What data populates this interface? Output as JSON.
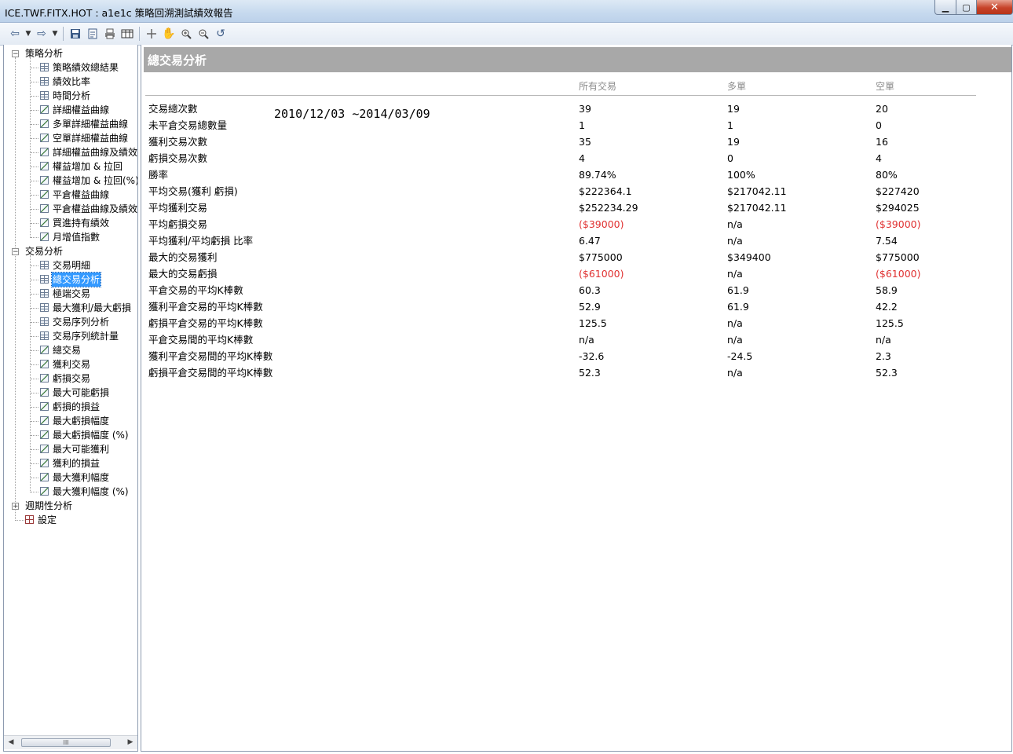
{
  "window": {
    "title": "ICE.TWF.FITX.HOT : a1e1c 策略回溯測試績效報告",
    "buttons": {
      "minimize": "▁",
      "maximize": "▢",
      "close": "✕"
    }
  },
  "toolbar": {
    "icons": [
      "back-icon",
      "forward-icon",
      "save-icon",
      "export-icon",
      "print-icon",
      "table-view-icon",
      "crosshair-icon",
      "pan-hand-icon",
      "zoom-in-icon",
      "zoom-out-icon",
      "reset-zoom-icon"
    ]
  },
  "tree": {
    "groups": [
      {
        "label": "策略分析",
        "expanded": true,
        "items": [
          {
            "label": "策略績效總結果",
            "icon": "grid"
          },
          {
            "label": "績效比率",
            "icon": "grid"
          },
          {
            "label": "時間分析",
            "icon": "grid"
          },
          {
            "label": "詳細權益曲線",
            "icon": "chart"
          },
          {
            "label": "多單詳細權益曲線",
            "icon": "chart"
          },
          {
            "label": "空單詳細權益曲線",
            "icon": "chart"
          },
          {
            "label": "詳細權益曲線及績效",
            "icon": "chart"
          },
          {
            "label": "權益增加 & 拉回",
            "icon": "chart"
          },
          {
            "label": "權益增加 & 拉回(%)",
            "icon": "chart"
          },
          {
            "label": "平倉權益曲線",
            "icon": "chart"
          },
          {
            "label": "平倉權益曲線及績效",
            "icon": "chart"
          },
          {
            "label": "買進持有績效",
            "icon": "chart"
          },
          {
            "label": "月增值指數",
            "icon": "chart"
          }
        ]
      },
      {
        "label": "交易分析",
        "expanded": true,
        "items": [
          {
            "label": "交易明細",
            "icon": "grid"
          },
          {
            "label": "總交易分析",
            "icon": "grid",
            "selected": true
          },
          {
            "label": "極端交易",
            "icon": "grid"
          },
          {
            "label": "最大獲利/最大虧損",
            "icon": "grid"
          },
          {
            "label": "交易序列分析",
            "icon": "grid"
          },
          {
            "label": "交易序列統計量",
            "icon": "grid"
          },
          {
            "label": "總交易",
            "icon": "chart"
          },
          {
            "label": "獲利交易",
            "icon": "chart"
          },
          {
            "label": "虧損交易",
            "icon": "chart"
          },
          {
            "label": "最大可能虧損",
            "icon": "chart"
          },
          {
            "label": "虧損的損益",
            "icon": "chart"
          },
          {
            "label": "最大虧損幅度",
            "icon": "chart"
          },
          {
            "label": "最大虧損幅度 (%)",
            "icon": "chart"
          },
          {
            "label": "最大可能獲利",
            "icon": "chart"
          },
          {
            "label": "獲利的損益",
            "icon": "chart"
          },
          {
            "label": "最大獲利幅度",
            "icon": "chart"
          },
          {
            "label": "最大獲利幅度 (%)",
            "icon": "chart"
          }
        ]
      },
      {
        "label": "週期性分析",
        "expanded": false,
        "items": []
      },
      {
        "label": "設定",
        "leaf": true,
        "icon": "settings",
        "items": []
      }
    ],
    "scroll_thumb": "III"
  },
  "report": {
    "section_title": "總交易分析",
    "date_range": "2010/12/03 ~2014/03/09",
    "columns": [
      "所有交易",
      "多單",
      "空單"
    ],
    "rows": [
      {
        "label": "交易總次數",
        "values": [
          "39",
          "19",
          "20"
        ]
      },
      {
        "label": "未平倉交易總數量",
        "values": [
          "1",
          "1",
          "0"
        ]
      },
      {
        "label": "獲利交易次數",
        "values": [
          "35",
          "19",
          "16"
        ]
      },
      {
        "label": "虧損交易次數",
        "values": [
          "4",
          "0",
          "4"
        ]
      },
      {
        "label": "勝率",
        "values": [
          "89.74%",
          "100%",
          "80%"
        ]
      },
      {
        "label": "平均交易(獲利 虧損)",
        "values": [
          "$222364.1",
          "$217042.11",
          "$227420"
        ]
      },
      {
        "label": "平均獲利交易",
        "values": [
          "$252234.29",
          "$217042.11",
          "$294025"
        ]
      },
      {
        "label": "平均虧損交易",
        "values": [
          "($39000)",
          "n/a",
          "($39000)"
        ],
        "negative": [
          true,
          false,
          true
        ]
      },
      {
        "label": "平均獲利/平均虧損 比率",
        "values": [
          "6.47",
          "n/a",
          "7.54"
        ]
      },
      {
        "label": "最大的交易獲利",
        "values": [
          "$775000",
          "$349400",
          "$775000"
        ]
      },
      {
        "label": "最大的交易虧損",
        "values": [
          "($61000)",
          "n/a",
          "($61000)"
        ],
        "negative": [
          true,
          false,
          true
        ]
      },
      {
        "label": "平倉交易的平均K棒數",
        "values": [
          "60.3",
          "61.9",
          "58.9"
        ]
      },
      {
        "label": "獲利平倉交易的平均K棒數",
        "values": [
          "52.9",
          "61.9",
          "42.2"
        ]
      },
      {
        "label": "虧損平倉交易的平均K棒數",
        "values": [
          "125.5",
          "n/a",
          "125.5"
        ]
      },
      {
        "label": "平倉交易間的平均K棒數",
        "values": [
          "n/a",
          "n/a",
          "n/a"
        ]
      },
      {
        "label": "獲利平倉交易間的平均K棒數",
        "values": [
          "-32.6",
          "-24.5",
          "2.3"
        ]
      },
      {
        "label": "虧損平倉交易間的平均K棒數",
        "values": [
          "52.3",
          "n/a",
          "52.3"
        ]
      }
    ],
    "colors": {
      "negative": "#e03030",
      "header_band": "#a8a8a8",
      "column_header": "#8c8c8c"
    }
  }
}
